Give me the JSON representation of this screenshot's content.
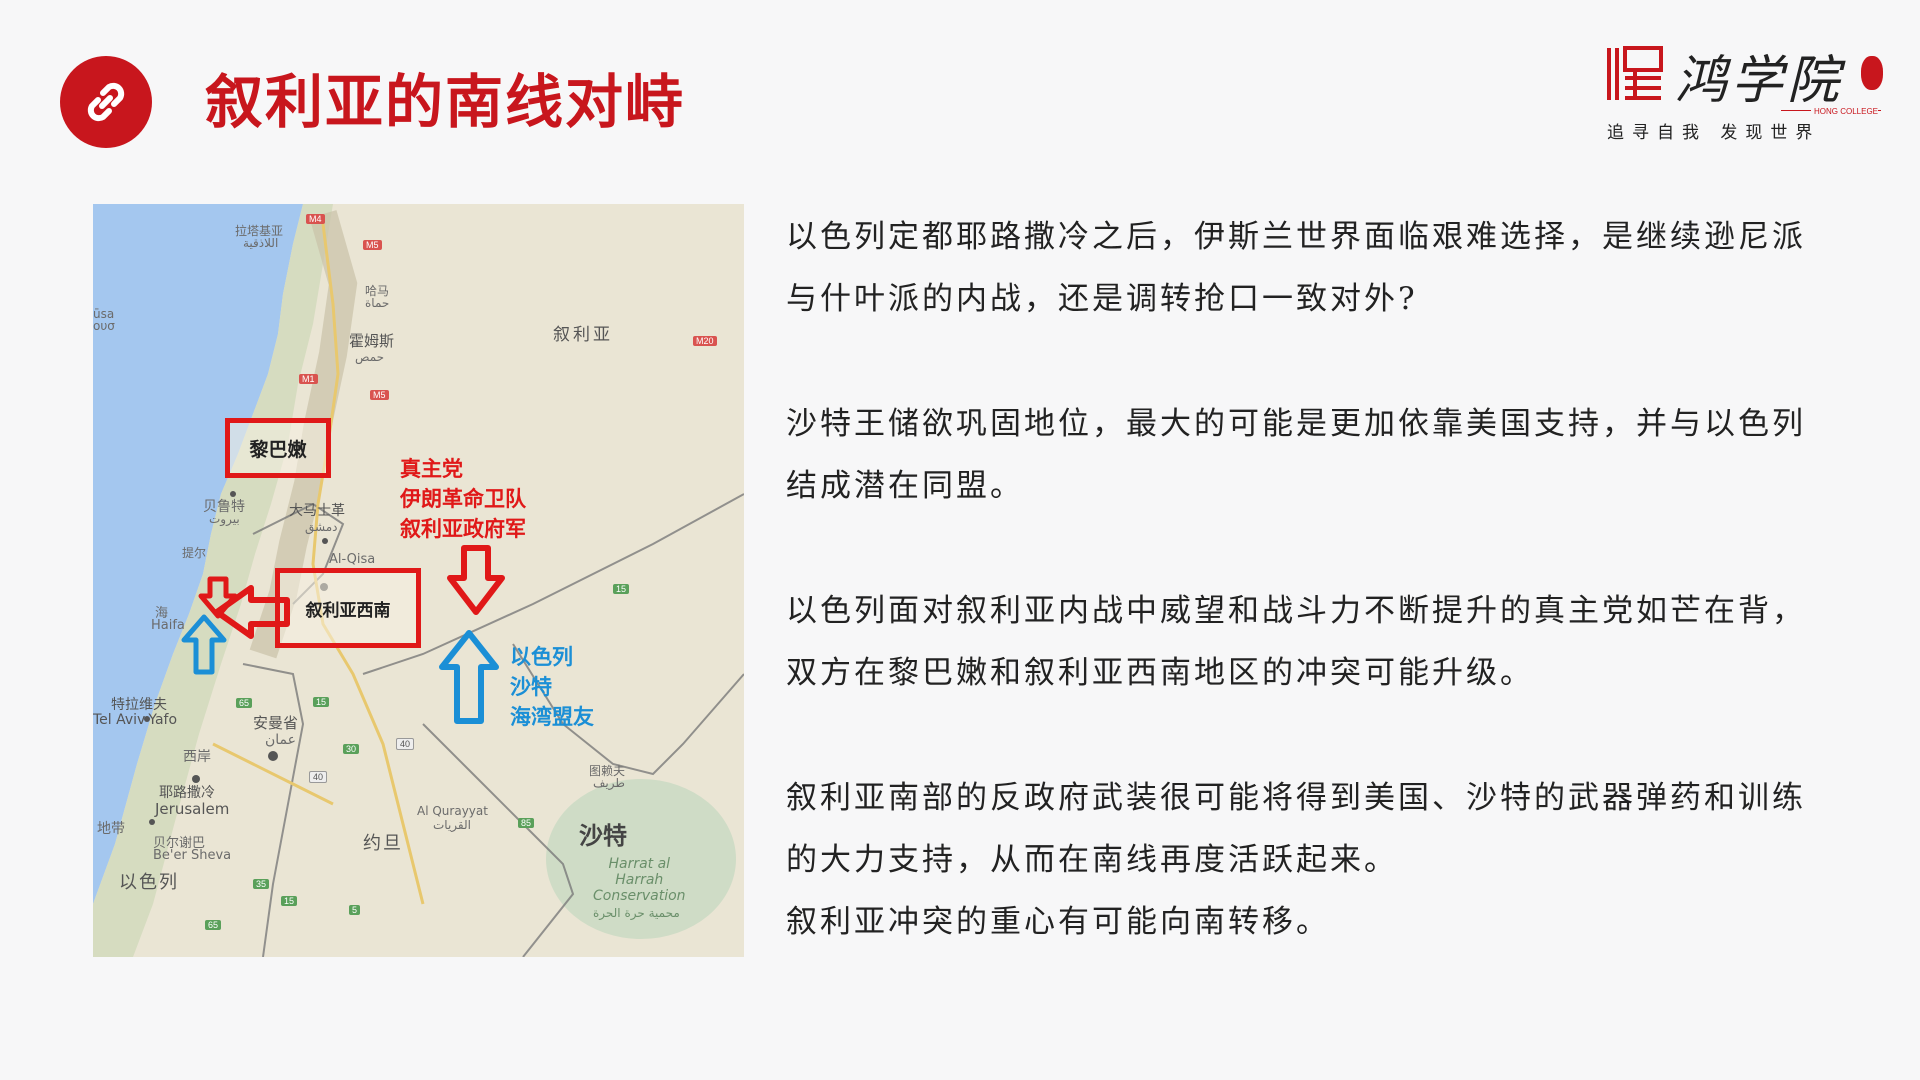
{
  "header": {
    "title": "叙利亚的南线对峙",
    "badge_icon": "link-icon",
    "accent_color": "#c8161d"
  },
  "logo": {
    "name": "鸿学院",
    "english": "HONG COLLEGE",
    "slogan": "追寻自我  发现世界"
  },
  "map": {
    "places": {
      "latakia_cn": "拉塔基亚",
      "latakia_ar": "اللاذقية",
      "hama_cn": "哈马",
      "hama_ar": "حماة",
      "homs_cn": "霍姆斯",
      "homs_ar": "حمص",
      "syria": "叙利亚",
      "lebanon": "黎巴嫩",
      "beirut_cn": "贝鲁特",
      "beirut_ar": "بيروت",
      "damascus_cn": "大马士革",
      "damascus_ar": "دمشق",
      "tyre": "提尔",
      "al_qisa": "Al-Qisa",
      "haifa": "Haifa",
      "haifa_cn": "海",
      "sw_syria": "叙利亚西南",
      "tel_aviv_cn": "特拉维夫",
      "tel_aviv": "Tel Aviv-Yafo",
      "amman_cn": "安曼省",
      "amman_ar": "عمان",
      "jerusalem_cn": "耶路撒冷",
      "jerusalem": "Jerusalem",
      "west_bank": "西岸",
      "beersheba_cn": "贝尔谢巴",
      "beersheba": "Be'er Sheva",
      "israel": "以色列",
      "jordan": "约旦",
      "al_qurayyat": "Al Qurayyat",
      "al_qurayyat_ar": "القريات",
      "saudi": "沙特",
      "harrat": "Harrat al\nHarrah\nConservation",
      "harrat_ar": "محمية حرة الحرة",
      "tabarjal": "图赖夫",
      "tabarjal_ar": "طريف",
      "cyprus": "ūsa\nουσ",
      "negev": "地带"
    },
    "routes": [
      "M4",
      "M5",
      "M1",
      "M5",
      "M20",
      "65",
      "15",
      "30",
      "40",
      "40",
      "15",
      "35",
      "5",
      "65",
      "15",
      "85"
    ],
    "red_group": [
      "真主党",
      "伊朗革命卫队",
      "叙利亚政府军"
    ],
    "blue_group": [
      "以色列",
      "沙特",
      "海湾盟友"
    ],
    "red_color": "#e01818",
    "blue_color": "#1b8fd6"
  },
  "paragraphs": [
    "以色列定都耶路撒冷之后，伊斯兰世界面临艰难选择，是继续逊尼派与什叶派的内战，还是调转抢口一致对外?",
    "沙特王储欲巩固地位，最大的可能是更加依靠美国支持，并与以色列结成潜在同盟。",
    "以色列面对叙利亚内战中威望和战斗力不断提升的真主党如芒在背，双方在黎巴嫩和叙利亚西南地区的冲突可能升级。",
    "叙利亚南部的反政府武装很可能将得到美国、沙特的武器弹药和训练的大力支持，从而在南线再度活跃起来。",
    "叙利亚冲突的重心有可能向南转移。"
  ]
}
